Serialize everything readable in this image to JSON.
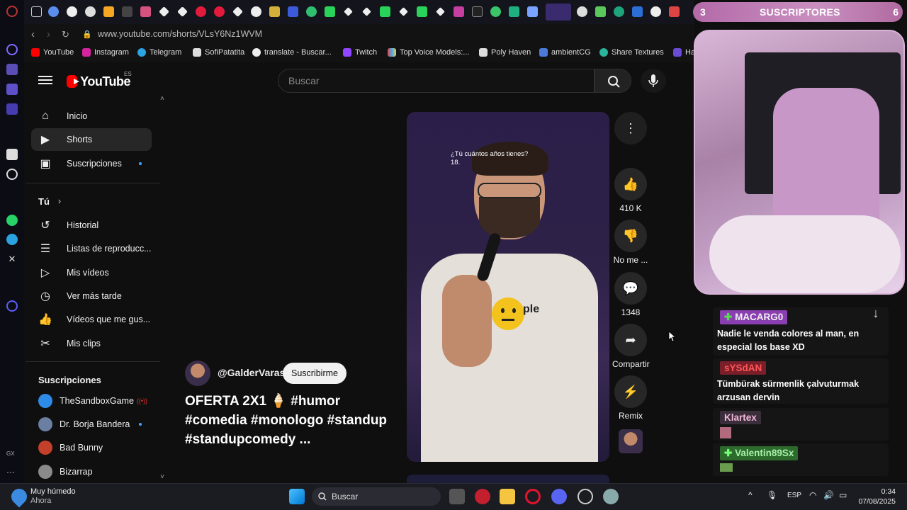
{
  "browser": {
    "url": "www.youtube.com/shorts/VLsY6Nz1WVM",
    "bookmarks": [
      "YouTube",
      "Instagram",
      "Telegram",
      "SofiPatatita",
      "translate - Buscar...",
      "Twitch",
      "Top Voice Models:...",
      "Poly Haven",
      "ambientCG",
      "Share Textures",
      "Ha"
    ]
  },
  "youtube": {
    "logo": "YouTube",
    "region": "ES",
    "search_placeholder": "Buscar",
    "nav": {
      "main": [
        "Inicio",
        "Shorts",
        "Suscripciones"
      ],
      "you_title": "Tú",
      "you": [
        "Historial",
        "Listas de reproducc...",
        "Mis vídeos",
        "Ver más tarde",
        "Vídeos que me gus...",
        "Mis clips"
      ],
      "subs_title": "Suscripciones",
      "subs": [
        "TheSandboxGame",
        "Dr. Borja Bandera",
        "Bad Bunny",
        "Bizarrap"
      ]
    },
    "short": {
      "caption_line1": "¿Tú cuántos años tienes?",
      "caption_line2": "18.",
      "logo_text": "ple",
      "channel": "@GalderVaras",
      "subscribe_label": "Suscribirme",
      "title": "OFERTA 2X1 🍦 #humor #comedia #monologo #standup #standupcomedy ...",
      "likes": "410 K",
      "dislike_label": "No me ...",
      "comments": "1348",
      "share_label": "Compartir",
      "remix_label": "Remix"
    }
  },
  "stream_overlay": {
    "sub_count_left": "3",
    "sub_label": "SUSCRIPTORES",
    "sub_count_right": "6",
    "chat": [
      {
        "user": "MACARG0",
        "color": "#8a3fb0",
        "text": "Nadie le venda colores al man, en especial los base XD"
      },
      {
        "user": "sYSdAN",
        "color": "#7a1f2a",
        "text": "Tümbürak sürmenlik çalvuturmak arzusan dervin"
      },
      {
        "user": "Klartex",
        "color": "#3a2e3a",
        "text": ""
      },
      {
        "user": "Valentin89Sx",
        "color": "#2d6b2d",
        "text": ""
      }
    ]
  },
  "taskbar": {
    "weather_title": "Muy húmedo",
    "weather_sub": "Ahora",
    "search_label": "Buscar",
    "lang": "ESP",
    "time": "0:34",
    "date": "07/08/2025"
  }
}
